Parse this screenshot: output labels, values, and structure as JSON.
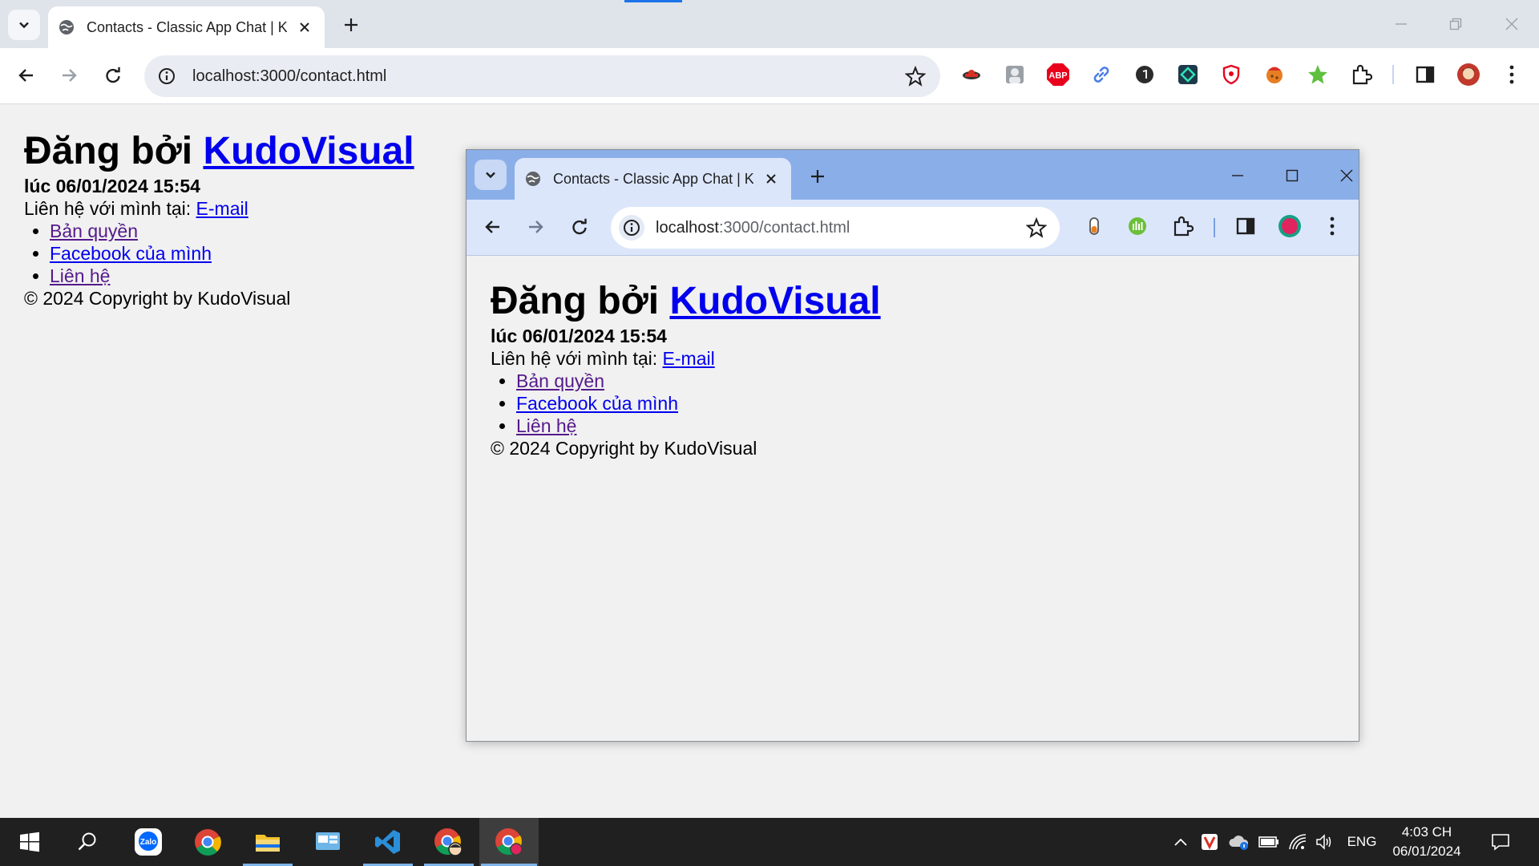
{
  "browser": {
    "tab_title": "Contacts - Classic App Chat | Ku",
    "url": "localhost:3000/contact.html",
    "extensions": [
      "cat-ext-icon",
      "profile-card-icon",
      "abp-icon",
      "link-icon",
      "dark-circle-icon",
      "code-ext-icon",
      "shield-icon",
      "cookie-icon",
      "star-ext-icon",
      "puzzle-icon"
    ],
    "abp_label": "ABP"
  },
  "page": {
    "heading_prefix": "Đăng bởi ",
    "heading_link": "KudoVisual",
    "posted_at": "lúc 06/01/2024 15:54",
    "contact_prefix": "Liên hệ với mình tại: ",
    "email_link": "E-mail",
    "links": [
      "Bản quyền",
      "Facebook của mình",
      "Liên hệ"
    ],
    "copyright": "© 2024 Copyright by KudoVisual"
  },
  "inner_browser": {
    "tab_title": "Contacts - Classic App Chat | Ku",
    "url_host": "localhost",
    "url_path": ":3000/contact.html"
  },
  "taskbar": {
    "apps": [
      "windows-start",
      "search",
      "zalo",
      "chrome",
      "file-explorer",
      "control-panel",
      "vscode",
      "chrome-profile",
      "chrome-active"
    ],
    "zalo_label": "Zalo",
    "lang": "ENG",
    "time": "4:03 CH",
    "date": "06/01/2024"
  },
  "colors": {
    "link": "#0000ee",
    "visited": "#551a8b",
    "inner_frame": "#8aaee8",
    "accent": "#1a73e8"
  }
}
